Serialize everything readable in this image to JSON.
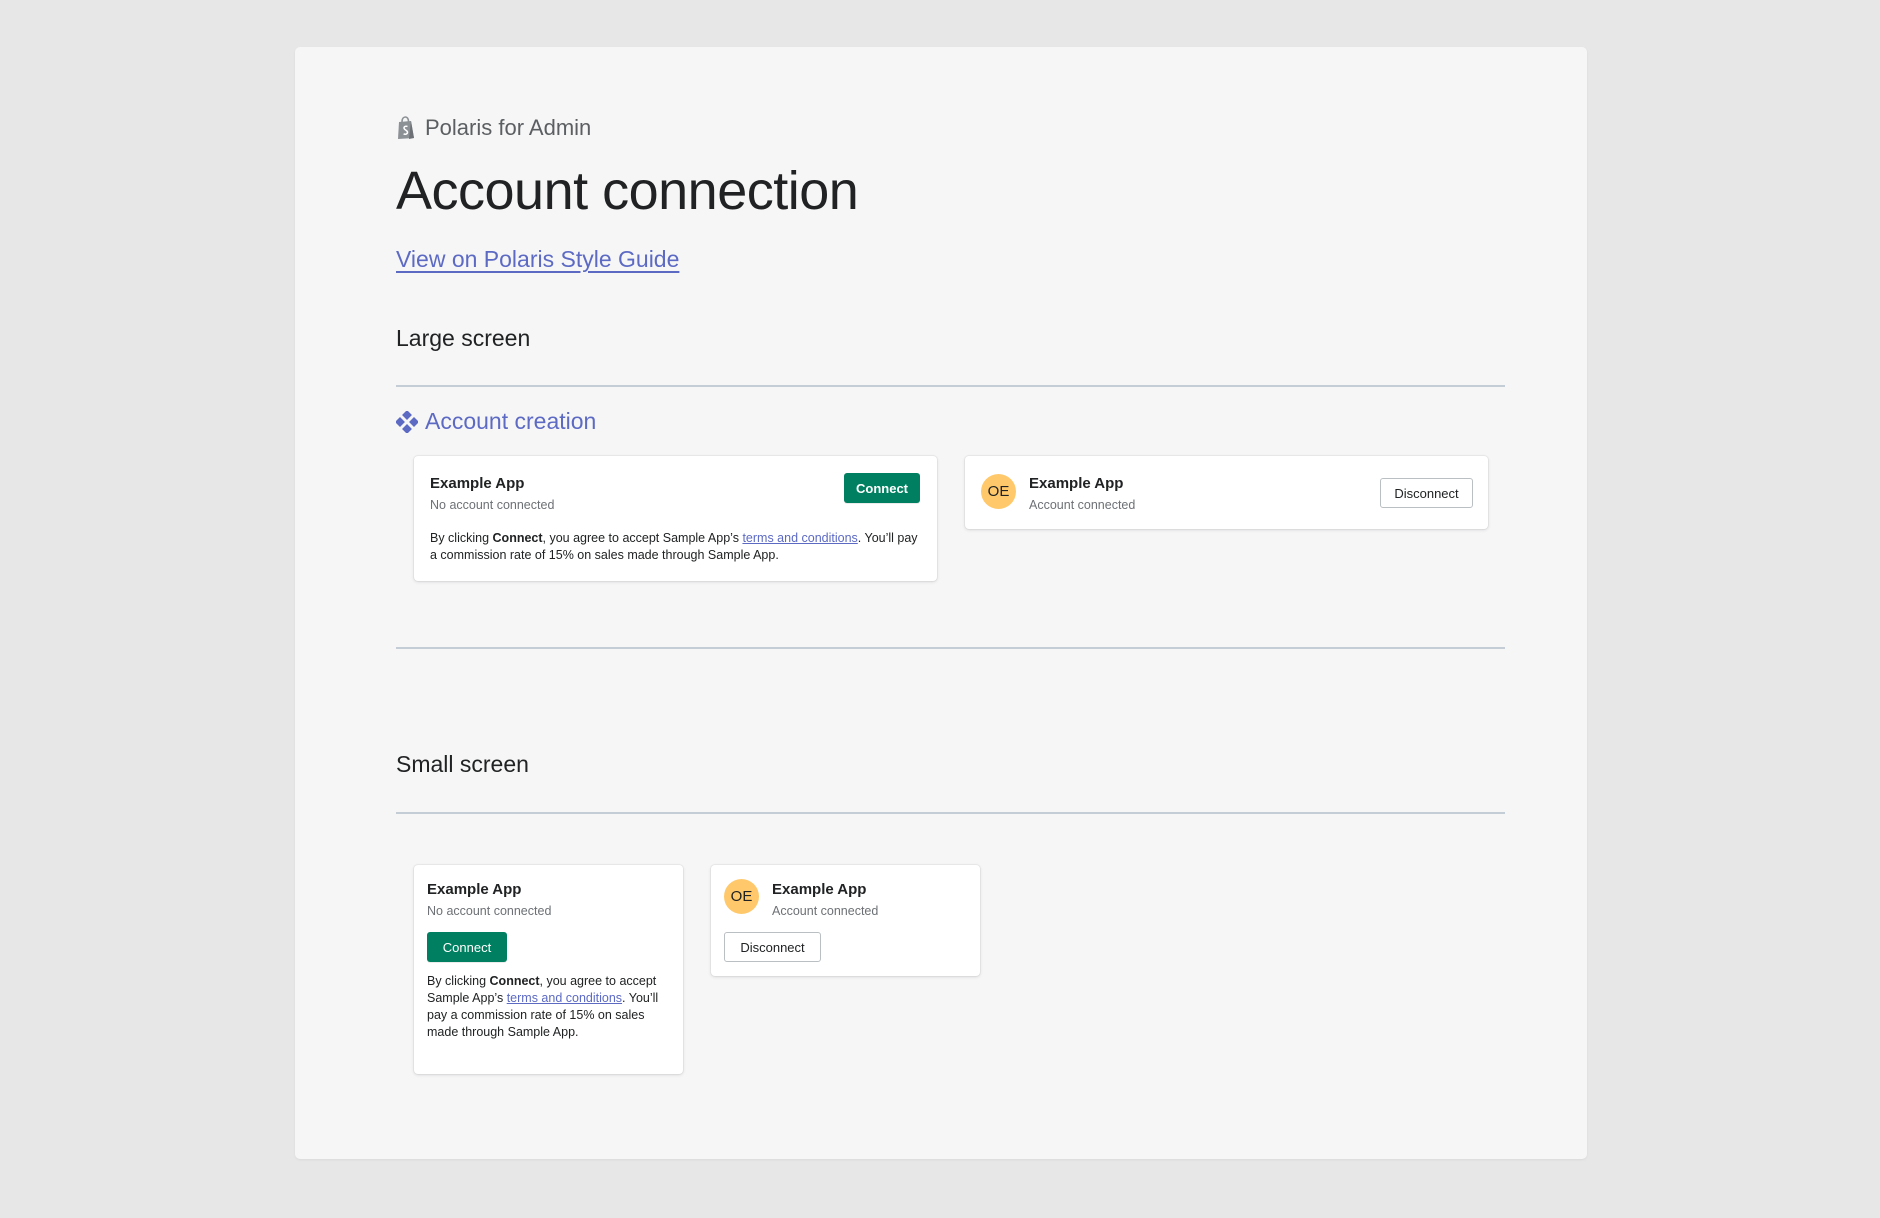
{
  "brand": {
    "name": "Polaris for Admin",
    "icon": "shopping-bag-icon"
  },
  "page": {
    "title": "Account connection",
    "guide_link": "View on Polaris Style Guide"
  },
  "colors": {
    "primary": "#008060",
    "link": "#5c6ac4",
    "avatar": "#ffc96b",
    "background": "#e7e7e7",
    "canvas": "#f6f6f6"
  },
  "large": {
    "heading": "Large screen",
    "subsection": "Account creation",
    "disconnected_card": {
      "app_name": "Example App",
      "status": "No account connected",
      "button": "Connect",
      "terms_prefix": "By clicking ",
      "terms_bold": "Connect",
      "terms_middle": ", you agree to accept Sample App’s ",
      "terms_link": "terms and conditions",
      "terms_suffix": ". You’ll pay a commission rate of 15% on sales made through Sample App."
    },
    "connected_card": {
      "avatar": "OE",
      "app_name": "Example App",
      "status": "Account connected",
      "button": "Disconnect"
    }
  },
  "small": {
    "heading": "Small screen",
    "disconnected_card": {
      "app_name": "Example App",
      "status": "No account connected",
      "button": "Connect",
      "terms_prefix": "By clicking ",
      "terms_bold": "Connect",
      "terms_middle": ", you agree to accept Sample App’s ",
      "terms_link": "terms and conditions",
      "terms_suffix": ". You’ll pay a commission rate of 15% on sales made through Sample App."
    },
    "connected_card": {
      "avatar": "OE",
      "app_name": "Example App",
      "status": "Account connected",
      "button": "Disconnect"
    }
  }
}
